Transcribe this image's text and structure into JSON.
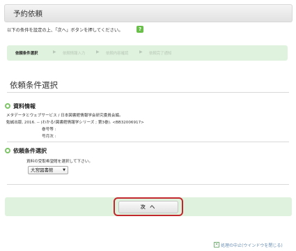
{
  "header": {
    "title": "予約依頼"
  },
  "instruction": {
    "text": "以下の条件を設定の上、「次へ」ボタンを押してください。",
    "help_icon": "help-icon",
    "help_glyph": "?"
  },
  "steps": [
    {
      "label": "依頼条件選択",
      "active": true
    },
    {
      "label": "依頼情報入力",
      "active": false
    },
    {
      "label": "依頼内容確認",
      "active": false
    },
    {
      "label": "依頼完了通知",
      "active": false
    }
  ],
  "step_separator": "▶",
  "section": {
    "title": "依頼条件選択"
  },
  "material_info": {
    "heading": "資料情報",
    "line1": "メタデータとウェブサービス / 日本図書館情報学会研究委員会編。",
    "line2": "勉誠出版, 2016. -- (わかる!図書館情報学シリーズ ; 第3巻). <BB32006917>",
    "volume_label": "巻号等 :",
    "issue_label": "号月次 :"
  },
  "request_conditions": {
    "heading": "依頼条件選択",
    "instruction": "資料の受取希望館を選択して下さい。",
    "library_select": "大宮図書館",
    "dropdown_glyph": "▼"
  },
  "actions": {
    "next_label": "次 へ",
    "cancel_label": "処理の中止(ウインドウを閉じる)",
    "close_glyph": "×"
  },
  "colors": {
    "accent_green": "#dff2dd",
    "bullet_green": "#7cc466",
    "highlight_red": "#c1272d",
    "link_blue": "#6a8fb5"
  }
}
